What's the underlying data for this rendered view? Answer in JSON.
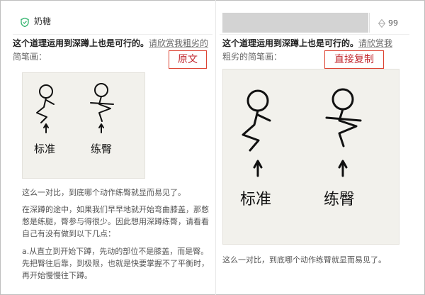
{
  "left": {
    "username": "奶糖",
    "intro_bold": "这个道理运用到深蹲上也是可行的。",
    "intro_link": "请欣赏我粗劣的",
    "intro_tail": "简笔画：",
    "stamp": "原文",
    "sketch_labels": [
      "标准",
      "练臀"
    ],
    "p2": "这么一对比，到底哪个动作练臀就显而易见了。",
    "p3": "在深蹲的途中，如果我们早早地就开始弯曲膝盖，那憋憋是练腿，臀参与得很少。因此想用深蹲练臀，请看看自己有没有做到以下几点：",
    "p4": "a.从直立到开始下蹲，先动的部位不是膝盖，而是臀。先把臀往后靠，到极限，也就是快要掌握不了平衡时，再开始慢慢往下蹲。"
  },
  "right": {
    "count": "99",
    "intro_bold": "这个道理运用到深蹲上也是可行的。",
    "intro_link": "请欣赏我",
    "intro_tail": "粗劣的简笔画：",
    "stamp": "直接复制",
    "sketch_labels": [
      "标准",
      "练臀"
    ],
    "p2": "这么一对比，到底哪个动作练臀就显而易见了。"
  },
  "colors": {
    "stamp": "#c1272d",
    "shield": "#2fb36b"
  },
  "icons": [
    "shield-icon",
    "refresh-icon",
    "diamond-icon"
  ]
}
